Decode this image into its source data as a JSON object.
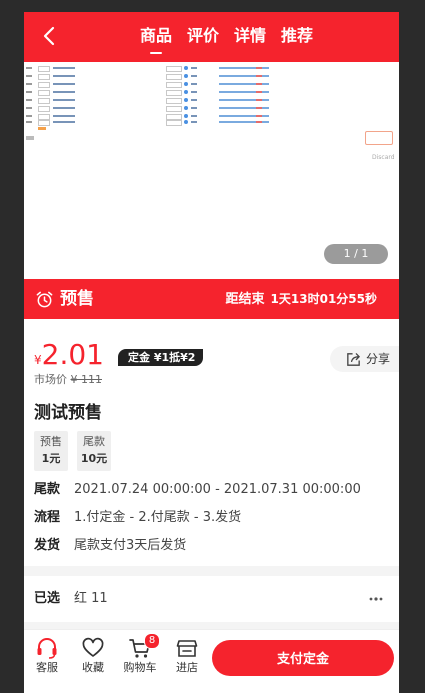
{
  "header": {
    "tabs": [
      {
        "label": "商品",
        "active": true
      },
      {
        "label": "评价",
        "active": false
      },
      {
        "label": "详情",
        "active": false
      },
      {
        "label": "推荐",
        "active": false
      }
    ]
  },
  "gallery": {
    "discard_label": "Discard",
    "counter": "1 / 1"
  },
  "presale": {
    "label": "预售",
    "countdown_label": "距结束",
    "countdown_value": "1天13时01分55秒"
  },
  "product": {
    "currency": "¥",
    "price": "2.01",
    "deposit_tag": "定金 ¥1抵¥2",
    "market_label": "市场价",
    "market_price": "¥ 111",
    "share_label": "分享",
    "title": "测试预售",
    "tags": [
      {
        "top": "预售",
        "bottom": "1元"
      },
      {
        "top": "尾款",
        "bottom": "10元"
      }
    ],
    "info": [
      {
        "key": "尾款",
        "value": "2021.07.24 00:00:00 - 2021.07.31 00:00:00"
      },
      {
        "key": "流程",
        "value": "1.付定金 - 2.付尾款 - 3.发货"
      },
      {
        "key": "发货",
        "value": "尾款支付3天后发货"
      }
    ]
  },
  "selected": {
    "label": "已选",
    "value": "红 11"
  },
  "bottom_bar": {
    "service_label": "客服",
    "favorite_label": "收藏",
    "cart_label": "购物车",
    "cart_count": "8",
    "store_label": "进店",
    "pay_button": "支付定金"
  },
  "colors": {
    "accent": "#f5232d",
    "dark_tag": "#222222"
  }
}
